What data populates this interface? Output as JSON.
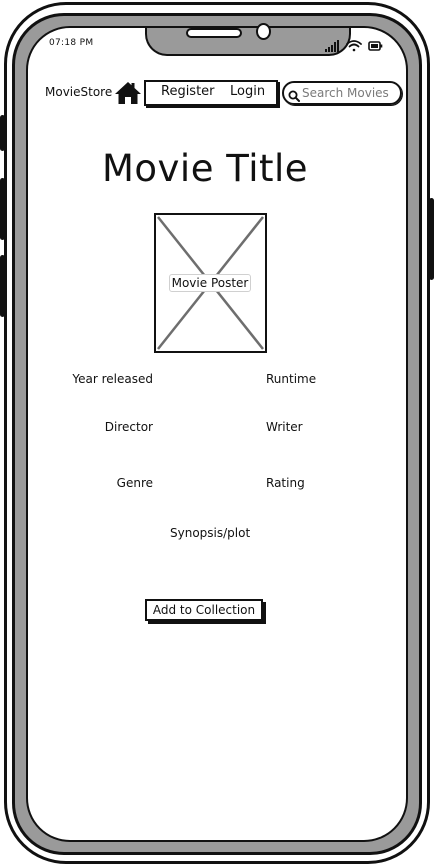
{
  "status_bar": {
    "time": "07:18 PM",
    "icons": [
      "signal-icon",
      "wifi-icon",
      "battery-icon"
    ]
  },
  "nav": {
    "brand": "MovieStore",
    "home_icon": "home-icon",
    "register_label": "Register",
    "login_label": "Login",
    "search_placeholder": "Search Movies",
    "search_icon": "search-icon"
  },
  "movie": {
    "title": "Movie Title",
    "poster_label": "Movie Poster",
    "fields": {
      "year_released": "Year released",
      "runtime": "Runtime",
      "director": "Director",
      "writer": "Writer",
      "genre": "Genre",
      "rating": "Rating",
      "synopsis": "Synopsis/plot"
    },
    "add_button_label": "Add to Collection"
  }
}
